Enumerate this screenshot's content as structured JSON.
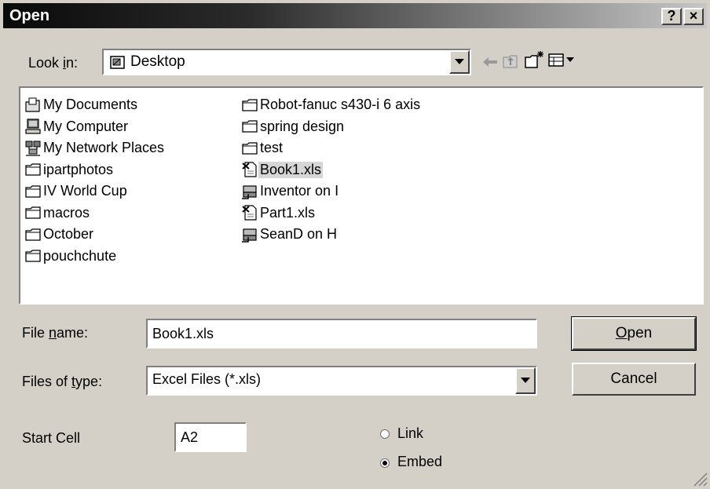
{
  "window": {
    "title": "Open"
  },
  "titlebar_buttons": {
    "help": "?",
    "close": "×"
  },
  "lookin": {
    "label_prefix": "Look ",
    "label_accel": "i",
    "label_suffix": "n:",
    "value": "Desktop"
  },
  "toolbar": {
    "back_icon": "back-arrow-icon",
    "up_icon": "up-folder-icon",
    "newfolder_icon": "new-folder-icon",
    "views_icon": "views-menu-icon"
  },
  "files": {
    "column1": [
      {
        "name": "My Documents",
        "icon": "my-documents-icon"
      },
      {
        "name": "My Computer",
        "icon": "my-computer-icon"
      },
      {
        "name": "My Network Places",
        "icon": "network-places-icon"
      },
      {
        "name": "ipartphotos",
        "icon": "folder-icon"
      },
      {
        "name": "IV World Cup",
        "icon": "folder-icon"
      },
      {
        "name": "macros",
        "icon": "folder-icon"
      },
      {
        "name": "October",
        "icon": "folder-icon"
      },
      {
        "name": "pouchchute",
        "icon": "folder-icon"
      }
    ],
    "column2": [
      {
        "name": "Robot-fanuc s430-i 6 axis",
        "icon": "folder-icon"
      },
      {
        "name": "spring design",
        "icon": "folder-icon"
      },
      {
        "name": "test",
        "icon": "folder-icon"
      },
      {
        "name": "Book1.xls",
        "icon": "excel-file-icon",
        "selected": true
      },
      {
        "name": "Inventor on I",
        "icon": "shortcut-icon"
      },
      {
        "name": "Part1.xls",
        "icon": "excel-file-icon"
      },
      {
        "name": "SeanD on H",
        "icon": "shortcut-icon"
      }
    ]
  },
  "filename": {
    "label_prefix": "File ",
    "label_accel": "n",
    "label_suffix": "ame:",
    "value": "Book1.xls"
  },
  "filetype": {
    "label_prefix": "Files of ",
    "label_accel": "t",
    "label_suffix": "ype:",
    "value": "Excel Files (*.xls)"
  },
  "buttons": {
    "open_accel": "O",
    "open_rest": "pen",
    "cancel": "Cancel"
  },
  "startcell": {
    "label": "Start Cell",
    "value": "A2"
  },
  "radios": {
    "link": "Link",
    "embed": "Embed",
    "selected": "embed"
  }
}
